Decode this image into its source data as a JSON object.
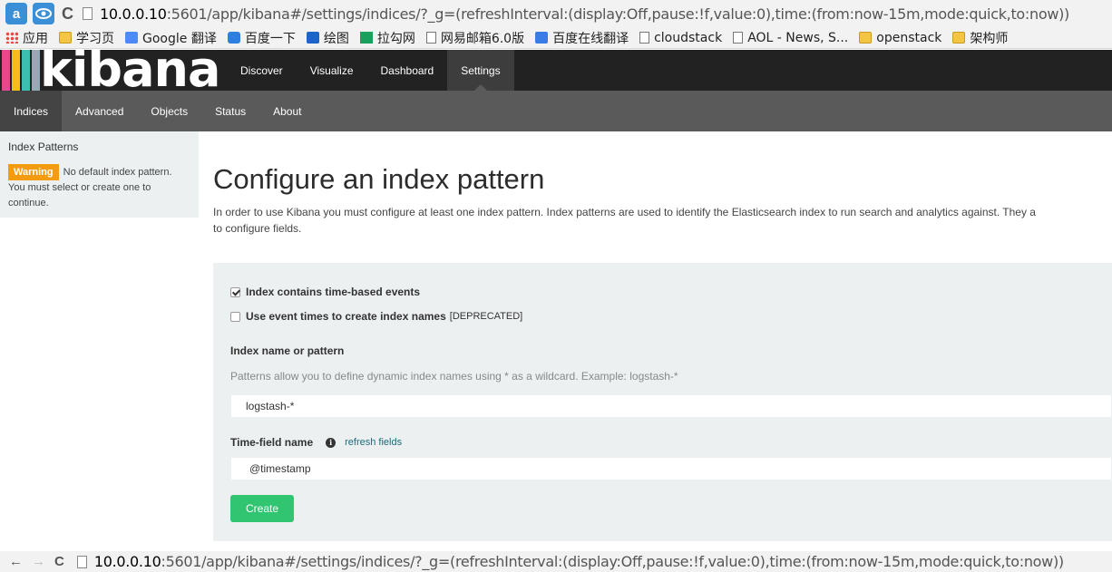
{
  "browser": {
    "url_host": "10.0.0.10",
    "url_rest": ":5601/app/kibana#/settings/indices/?_g=(refreshInterval:(display:Off,pause:!f,value:0),time:(from:now-15m,mode:quick,to:now))"
  },
  "bookmarks": [
    {
      "label": "应用",
      "icon": "apps-icon"
    },
    {
      "label": "学习页",
      "icon": "folder-icon"
    },
    {
      "label": "Google 翻译",
      "icon": "google-translate-icon"
    },
    {
      "label": "百度一下",
      "icon": "baidu-icon"
    },
    {
      "label": "绘图",
      "icon": "on-icon"
    },
    {
      "label": "拉勾网",
      "icon": "lagou-icon"
    },
    {
      "label": "网易邮箱6.0版",
      "icon": "page-icon"
    },
    {
      "label": "百度在线翻译",
      "icon": "fanyi-icon"
    },
    {
      "label": "cloudstack",
      "icon": "page-icon"
    },
    {
      "label": "AOL - News, S...",
      "icon": "page-icon"
    },
    {
      "label": "openstack",
      "icon": "folder-icon"
    },
    {
      "label": "架构师",
      "icon": "folder-icon"
    }
  ],
  "kibana": {
    "logo": "kibana",
    "logo_colors": [
      "#e8488b",
      "#f4bd19",
      "#3cbeb1",
      "#98a9b6"
    ],
    "nav": [
      "Discover",
      "Visualize",
      "Dashboard",
      "Settings"
    ],
    "nav_active": "Settings",
    "subnav": [
      "Indices",
      "Advanced",
      "Objects",
      "Status",
      "About"
    ],
    "subnav_active": "Indices"
  },
  "sidebar": {
    "heading": "Index Patterns",
    "warning_badge": "Warning",
    "warning_text_1": "No default index pattern.",
    "warning_text_2": "You must select or create one to",
    "warning_text_3": "continue."
  },
  "main": {
    "title": "Configure an index pattern",
    "intro_1": "In order to use Kibana you must configure at least one index pattern. Index patterns are used to identify the Elasticsearch index to run search and analytics against. They a",
    "intro_2": "to configure fields."
  },
  "form": {
    "time_based_label": "Index contains time-based events",
    "time_based_checked": true,
    "event_times_label": "Use event times to create index names",
    "event_times_suffix": "[DEPRECATED]",
    "event_times_checked": false,
    "index_label": "Index name or pattern",
    "index_help": "Patterns allow you to define dynamic index names using * as a wildcard. Example: logstash-*",
    "index_value": "logstash-*",
    "time_field_label": "Time-field name",
    "refresh_link": "refresh fields",
    "time_field_value": "@timestamp",
    "create_label": "Create",
    "create_color": "#31c471"
  }
}
